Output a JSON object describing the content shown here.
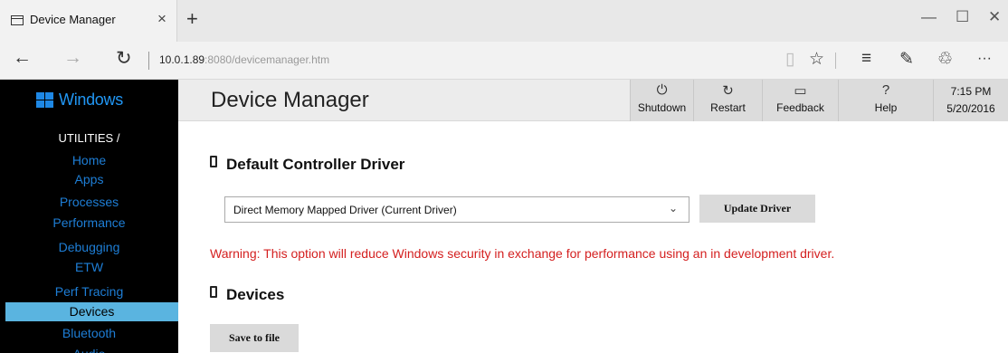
{
  "browser": {
    "tab_title": "Device Manager",
    "tab_close": "×",
    "new_tab": "+",
    "window_controls": {
      "minimize": "—",
      "maximize": "☐",
      "close": "✕"
    },
    "nav": {
      "back": "←",
      "forward": "→",
      "refresh": "↻"
    },
    "url_host": "10.0.1.89",
    "url_rest": ":8080/devicemanager.htm",
    "toolbar_icons": [
      "reading-view-icon",
      "favorite-star-icon",
      "hub-icon",
      "web-note-icon",
      "share-icon",
      "more-icon"
    ],
    "toolbar_glyphs": {
      "reading": "▯",
      "star": "☆",
      "hub": "≡",
      "note": "✎",
      "share": "♲",
      "more": "···"
    }
  },
  "sidebar": {
    "logo_text": "Windows",
    "section_label": "UTILITIES /",
    "items": [
      "Home",
      "Apps",
      "Processes",
      "Performance",
      "Debugging",
      "ETW",
      "Perf Tracing",
      "Devices",
      "Bluetooth",
      "Audio"
    ],
    "active_item": "Devices"
  },
  "header": {
    "title": "Device Manager",
    "buttons": [
      {
        "label": "Shutdown",
        "icon": "power-icon",
        "glyph": "⏻"
      },
      {
        "label": "Restart",
        "icon": "restart-icon",
        "glyph": "↻"
      },
      {
        "label": "Feedback",
        "icon": "feedback-icon",
        "glyph": "▭"
      },
      {
        "label": "Help",
        "icon": "help-icon",
        "glyph": "?"
      }
    ],
    "time": "7:15 PM",
    "date": "5/20/2016"
  },
  "main": {
    "driver_section_title": "Default Controller Driver",
    "driver_select_value": "Direct Memory Mapped Driver (Current Driver)",
    "update_button": "Update Driver",
    "warning": "Warning: This option will reduce Windows security in exchange for performance using an in development driver.",
    "devices_section_title": "Devices",
    "save_button": "Save to file"
  },
  "colors": {
    "sidebar_bg": "#000000",
    "sidebar_link": "#1e7ed6",
    "sidebar_active_bg": "#5ab4e0",
    "warning": "#d42020",
    "header_bg": "#ececec"
  }
}
